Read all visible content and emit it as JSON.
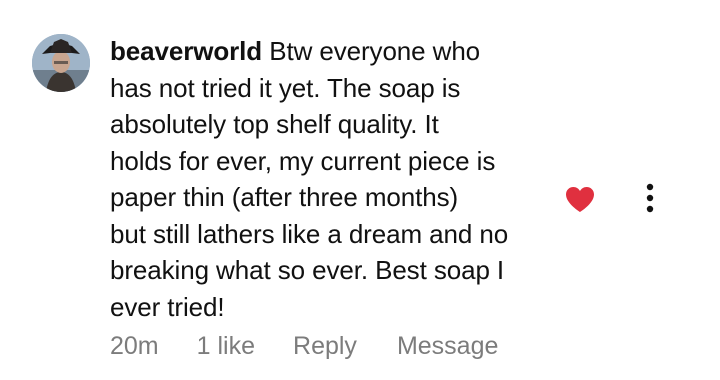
{
  "comment": {
    "username": "beaverworld",
    "lines": [
      "Btw everyone who",
      "has not tried it yet. The soap is",
      "absolutely top shelf quality. It",
      "holds for ever, my current piece is",
      "paper thin (after three months)",
      "but still lathers like a dream and no",
      "breaking what so ever. Best soap I",
      "ever tried!"
    ],
    "age": "20m",
    "likes": "1 like",
    "reply_label": "Reply",
    "message_label": "Message",
    "liked": true,
    "icons": {
      "like": "heart-icon",
      "more": "more-options-icon"
    },
    "colors": {
      "heart": "#e0303f",
      "meta_text": "#7c7c7c",
      "text": "#111111"
    }
  }
}
